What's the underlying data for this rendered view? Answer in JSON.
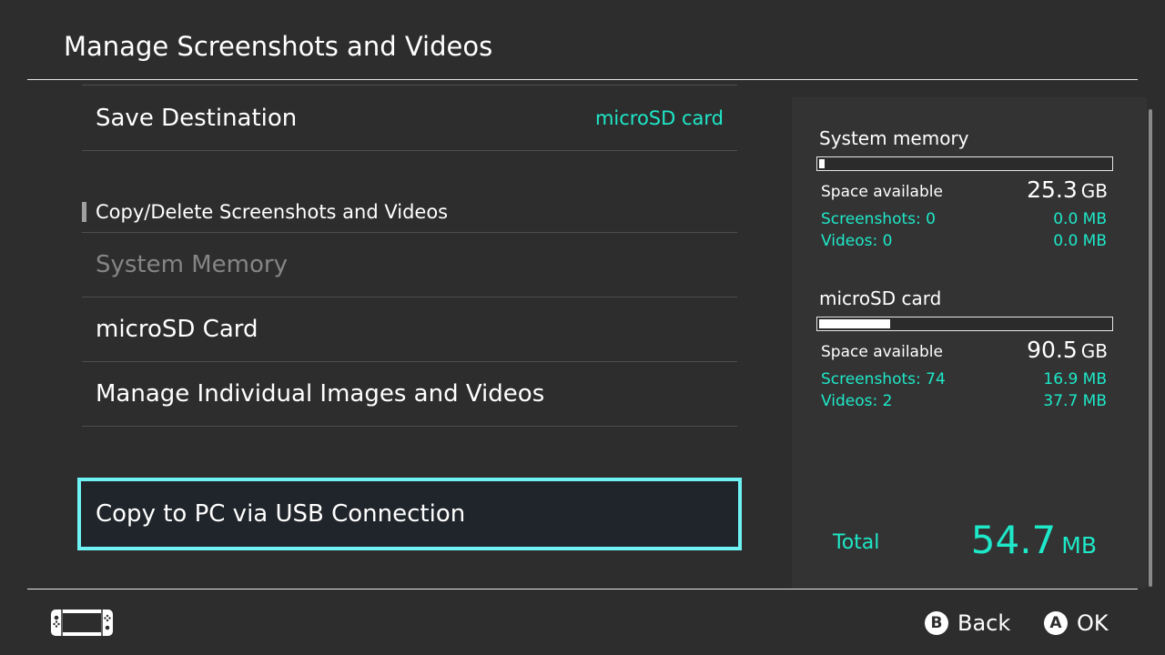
{
  "header": {
    "title": "Manage Screenshots and Videos"
  },
  "menu": {
    "save_destination": {
      "label": "Save Destination",
      "value": "microSD card"
    },
    "section_title": "Copy/Delete Screenshots and Videos",
    "system_memory": "System Memory",
    "microsd_card": "microSD Card",
    "manage_individual": "Manage Individual Images and Videos",
    "copy_usb": "Copy to PC via USB Connection"
  },
  "storage": {
    "system": {
      "title": "System memory",
      "space_label": "Space available",
      "space_value": "25.3",
      "space_unit": "GB",
      "used_fraction": 0.02,
      "screenshots_label": "Screenshots: 0",
      "screenshots_size": "0.0 MB",
      "videos_label": "Videos: 0",
      "videos_size": "0.0 MB"
    },
    "microsd": {
      "title": "microSD card",
      "space_label": "Space available",
      "space_value": "90.5",
      "space_unit": "GB",
      "used_fraction": 0.245,
      "screenshots_label": "Screenshots: 74",
      "screenshots_size": "16.9 MB",
      "videos_label": "Videos: 2",
      "videos_size": "37.7 MB"
    },
    "total": {
      "label": "Total",
      "value": "54.7",
      "unit": "MB"
    }
  },
  "footer": {
    "back": {
      "key": "B",
      "label": "Back"
    },
    "ok": {
      "key": "A",
      "label": "OK"
    }
  },
  "colors": {
    "accent": "#1ee8c8",
    "focus": "#6ef2f4",
    "background": "#2d2d2d"
  }
}
